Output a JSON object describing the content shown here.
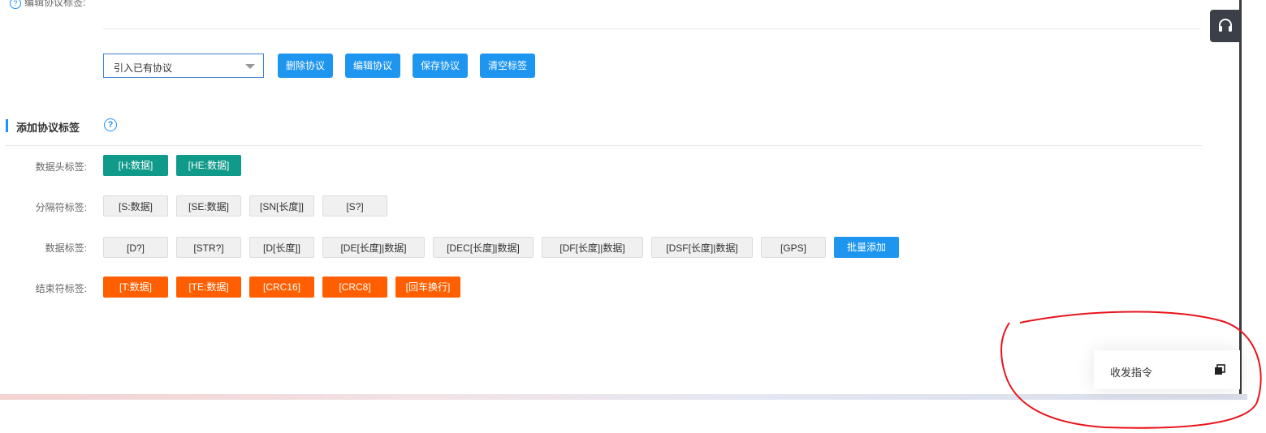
{
  "top_label": "编辑协议标签:",
  "protocol": {
    "select_value": "引入已有协议",
    "buttons": [
      "删除协议",
      "编辑协议",
      "保存协议",
      "清空标签"
    ]
  },
  "section": {
    "title": "添加协议标签",
    "help": "?"
  },
  "rows": {
    "header": {
      "label": "数据头标签:",
      "tags": [
        "[H:数据]",
        "[HE:数据]"
      ]
    },
    "separator": {
      "label": "分隔符标签:",
      "tags": [
        "[S:数据]",
        "[SE:数据]",
        "[SN[长度]]",
        "[S?]"
      ]
    },
    "data": {
      "label": "数据标签:",
      "tags": [
        "[D?]",
        "[STR?]",
        "[D[长度]]",
        "[DE[长度]|数据]",
        "[DEC[长度]|数据]",
        "[DF[长度]|数据]",
        "[DSF[长度]|数据]",
        "[GPS]"
      ],
      "batch_button": "批量添加"
    },
    "end": {
      "label": "结束符标签:",
      "tags": [
        "[T:数据]",
        "[TE:数据]",
        "[CRC16]",
        "[CRC8]",
        "[回车换行]"
      ]
    }
  },
  "float_panel": {
    "label": "收发指令",
    "icon": "restore-window-icon"
  },
  "support": {
    "icon": "headset-icon"
  },
  "colors": {
    "blue": "#1e96f0",
    "teal": "#0f9a8a",
    "orange": "#ff5f00",
    "annotation": "#e8141c"
  }
}
